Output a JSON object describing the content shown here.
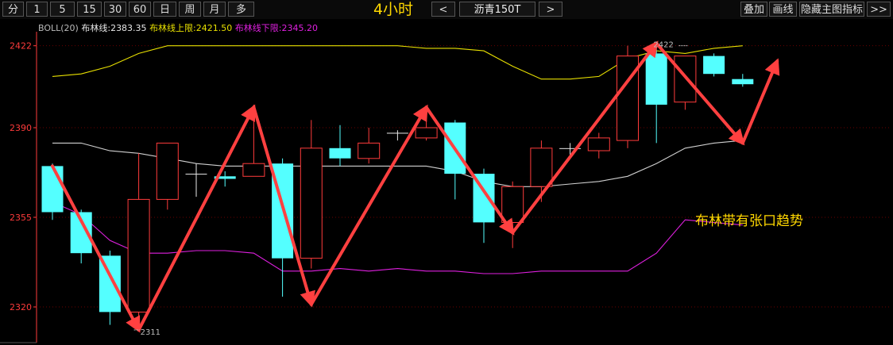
{
  "toolbar": {
    "periods": [
      "分",
      "1",
      "5",
      "15",
      "30",
      "60",
      "日",
      "周",
      "月",
      "多"
    ],
    "title": "4小时",
    "prev": "<",
    "next": ">",
    "instrument": "沥青150T",
    "right_buttons": [
      "叠加",
      "画线",
      "隐藏主图指标",
      ">>"
    ]
  },
  "legend": {
    "indicator": "BOLL(20)",
    "mid_label": "布林线:2383.35",
    "upper_label": "布林线上限:2421.50",
    "lower_label": "布林线下限:2345.20"
  },
  "colors": {
    "up": "#ff3b3b",
    "down": "#54ffff",
    "mid": "#d0d0d0",
    "upper": "#e8e000",
    "lower": "#e020e0",
    "arrow": "#ff4040",
    "annotation": "#ffd800",
    "axis": "#ff3b3b",
    "grid": "#6a0000"
  },
  "chart_data": {
    "type": "candlestick",
    "ylim": [
      2305,
      2430
    ],
    "yticks": [
      2320,
      2355,
      2390,
      2422
    ],
    "candles": [
      {
        "o": 2375,
        "h": 2376,
        "c": 2357,
        "l": 2354
      },
      {
        "o": 2357,
        "h": 2358,
        "c": 2341,
        "l": 2337
      },
      {
        "o": 2340,
        "h": 2342,
        "c": 2318,
        "l": 2313
      },
      {
        "o": 2318,
        "h": 2380,
        "c": 2362,
        "l": 2312
      },
      {
        "o": 2362,
        "h": 2384,
        "c": 2384,
        "l": 2358
      },
      {
        "o": 2372,
        "h": 2376,
        "c": 2372,
        "l": 2363
      },
      {
        "o": 2371,
        "h": 2373,
        "c": 2370,
        "l": 2367
      },
      {
        "o": 2371,
        "h": 2399,
        "c": 2376,
        "l": 2371
      },
      {
        "o": 2376,
        "h": 2378,
        "c": 2339,
        "l": 2324
      },
      {
        "o": 2339,
        "h": 2393,
        "c": 2382,
        "l": 2335
      },
      {
        "o": 2382,
        "h": 2391,
        "c": 2378,
        "l": 2375
      },
      {
        "o": 2378,
        "h": 2390,
        "c": 2384,
        "l": 2376
      },
      {
        "o": 2388,
        "h": 2389,
        "c": 2388,
        "l": 2385
      },
      {
        "o": 2386,
        "h": 2393,
        "c": 2390,
        "l": 2385
      },
      {
        "o": 2392,
        "h": 2393,
        "c": 2372,
        "l": 2362
      },
      {
        "o": 2372,
        "h": 2374,
        "c": 2353,
        "l": 2345
      },
      {
        "o": 2353,
        "h": 2369,
        "c": 2367,
        "l": 2343
      },
      {
        "o": 2367,
        "h": 2385,
        "c": 2382,
        "l": 2361
      },
      {
        "o": 2382,
        "h": 2384,
        "c": 2382,
        "l": 2379
      },
      {
        "o": 2381,
        "h": 2388,
        "c": 2386,
        "l": 2378
      },
      {
        "o": 2385,
        "h": 2422,
        "c": 2418,
        "l": 2382
      },
      {
        "o": 2419,
        "h": 2422,
        "c": 2399,
        "l": 2384
      },
      {
        "o": 2400,
        "h": 2418,
        "c": 2418,
        "l": 2397
      },
      {
        "o": 2418,
        "h": 2419,
        "c": 2411,
        "l": 2410
      },
      {
        "o": 2409,
        "h": 2411,
        "c": 2407,
        "l": 2406
      }
    ],
    "upper": [
      2410,
      2411,
      2414,
      2419,
      2422,
      2422,
      2422,
      2422,
      2422,
      2422,
      2422,
      2422,
      2422,
      2421,
      2421,
      2420,
      2414,
      2409,
      2409,
      2410,
      2417,
      2420,
      2419,
      2421,
      2422
    ],
    "middle": [
      2384,
      2384,
      2381,
      2380,
      2378,
      2376,
      2375,
      2375,
      2375,
      2375,
      2375,
      2375,
      2375,
      2375,
      2373,
      2369,
      2367,
      2367,
      2368,
      2369,
      2371,
      2376,
      2382,
      2384,
      2385
    ],
    "lower": [
      2361,
      2356,
      2346,
      2341,
      2341,
      2342,
      2342,
      2341,
      2334,
      2334,
      2335,
      2334,
      2335,
      2334,
      2334,
      2333,
      2333,
      2334,
      2334,
      2334,
      2334,
      2341,
      2354,
      2353,
      2352
    ],
    "point_labels": [
      {
        "index": 3,
        "price": 2311,
        "text": "2311"
      },
      {
        "index": 22,
        "price": 2422,
        "text": "2422"
      }
    ],
    "trend_arrows": [
      {
        "from": [
          0,
          2375
        ],
        "to": [
          3,
          2311
        ]
      },
      {
        "from": [
          3,
          2311
        ],
        "to": [
          7,
          2398
        ]
      },
      {
        "from": [
          7,
          2398
        ],
        "to": [
          9,
          2321
        ]
      },
      {
        "from": [
          9,
          2321
        ],
        "to": [
          13,
          2398
        ]
      },
      {
        "from": [
          13,
          2398
        ],
        "to": [
          16,
          2349
        ]
      },
      {
        "from": [
          16,
          2349
        ],
        "to": [
          21,
          2423
        ]
      },
      {
        "from": [
          21,
          2423
        ],
        "to": [
          24,
          2384
        ]
      },
      {
        "from": [
          24,
          2384
        ],
        "to": [
          25.2,
          2416
        ]
      }
    ],
    "annotation": "布林带有张口趋势"
  }
}
